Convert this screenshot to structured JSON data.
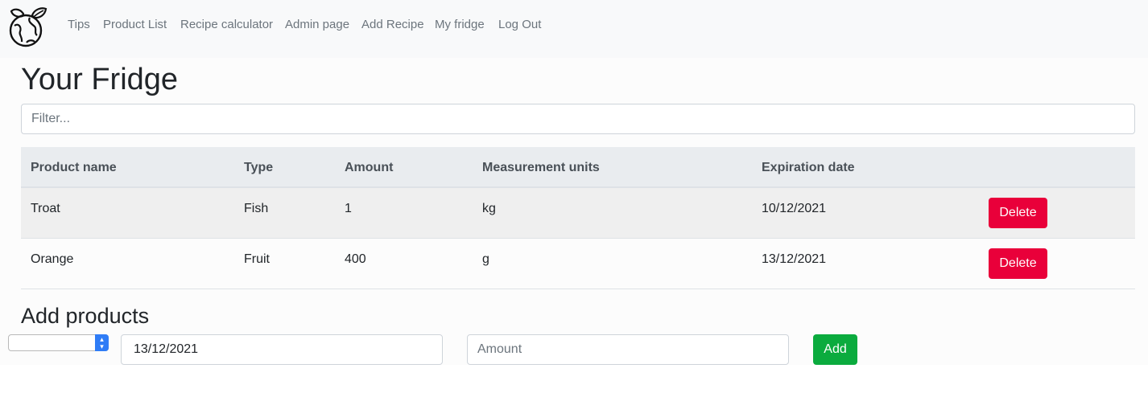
{
  "nav": {
    "logo_icon": "globe-leaf-icon",
    "links": [
      "Tips",
      "Product List",
      "Recipe calculator",
      "Admin page",
      "Add Recipe",
      "My fridge",
      "Log Out"
    ]
  },
  "page": {
    "title": "Your Fridge",
    "filter_placeholder": "Filter..."
  },
  "table": {
    "headers": [
      "Product name",
      "Type",
      "Amount",
      "Measurement units",
      "Expiration date"
    ],
    "rows": [
      {
        "name": "Troat",
        "type": "Fish",
        "amount": "1",
        "units": "kg",
        "expiration": "10/12/2021",
        "action": "Delete"
      },
      {
        "name": "Orange",
        "type": "Fruit",
        "amount": "400",
        "units": "g",
        "expiration": "13/12/2021",
        "action": "Delete"
      }
    ]
  },
  "add_products": {
    "title": "Add products",
    "product_select_value": "",
    "date_value": "13/12/2021",
    "amount_placeholder": "Amount",
    "add_label": "Add"
  },
  "colors": {
    "navbar_bg": "#f8f9fa",
    "danger": "#e9003a",
    "success": "#0bab3e",
    "table_header_bg": "#e9ecef",
    "select_accent": "#2f7cf6"
  }
}
